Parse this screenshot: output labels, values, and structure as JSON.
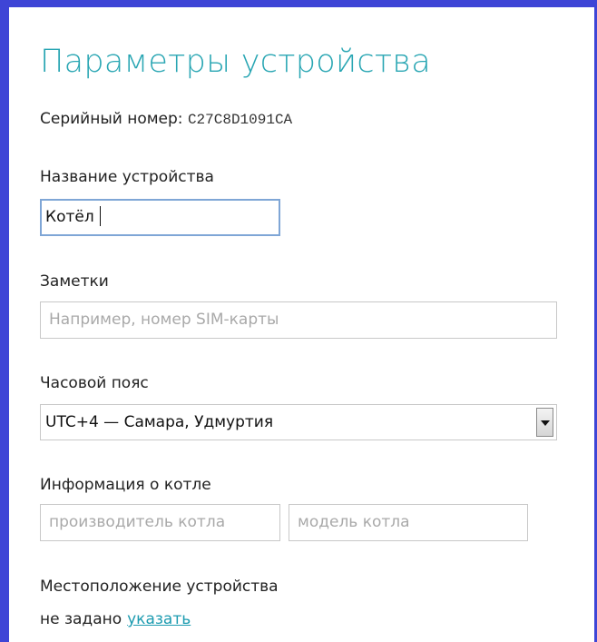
{
  "dialog": {
    "title": "Параметры устройства"
  },
  "serial": {
    "label": "Серийный номер:",
    "value": "C27C8D1091CA"
  },
  "device_name": {
    "label": "Название устройства",
    "value": "Котёл"
  },
  "notes": {
    "label": "Заметки",
    "placeholder": "Например, номер SIM-карты"
  },
  "timezone": {
    "label": "Часовой пояс",
    "selected": "UTC+4 — Самара, Удмуртия"
  },
  "boiler_info": {
    "label": "Информация о котле",
    "manufacturer_placeholder": "производитель котла",
    "model_placeholder": "модель котла"
  },
  "location": {
    "label": "Местоположение устройства",
    "state": "не задано",
    "link": "указать"
  },
  "colors": {
    "accent": "#29a6b3",
    "frame": "#3e45d6",
    "link": "#1c9bb0",
    "focus_border": "#7fa6d6"
  }
}
